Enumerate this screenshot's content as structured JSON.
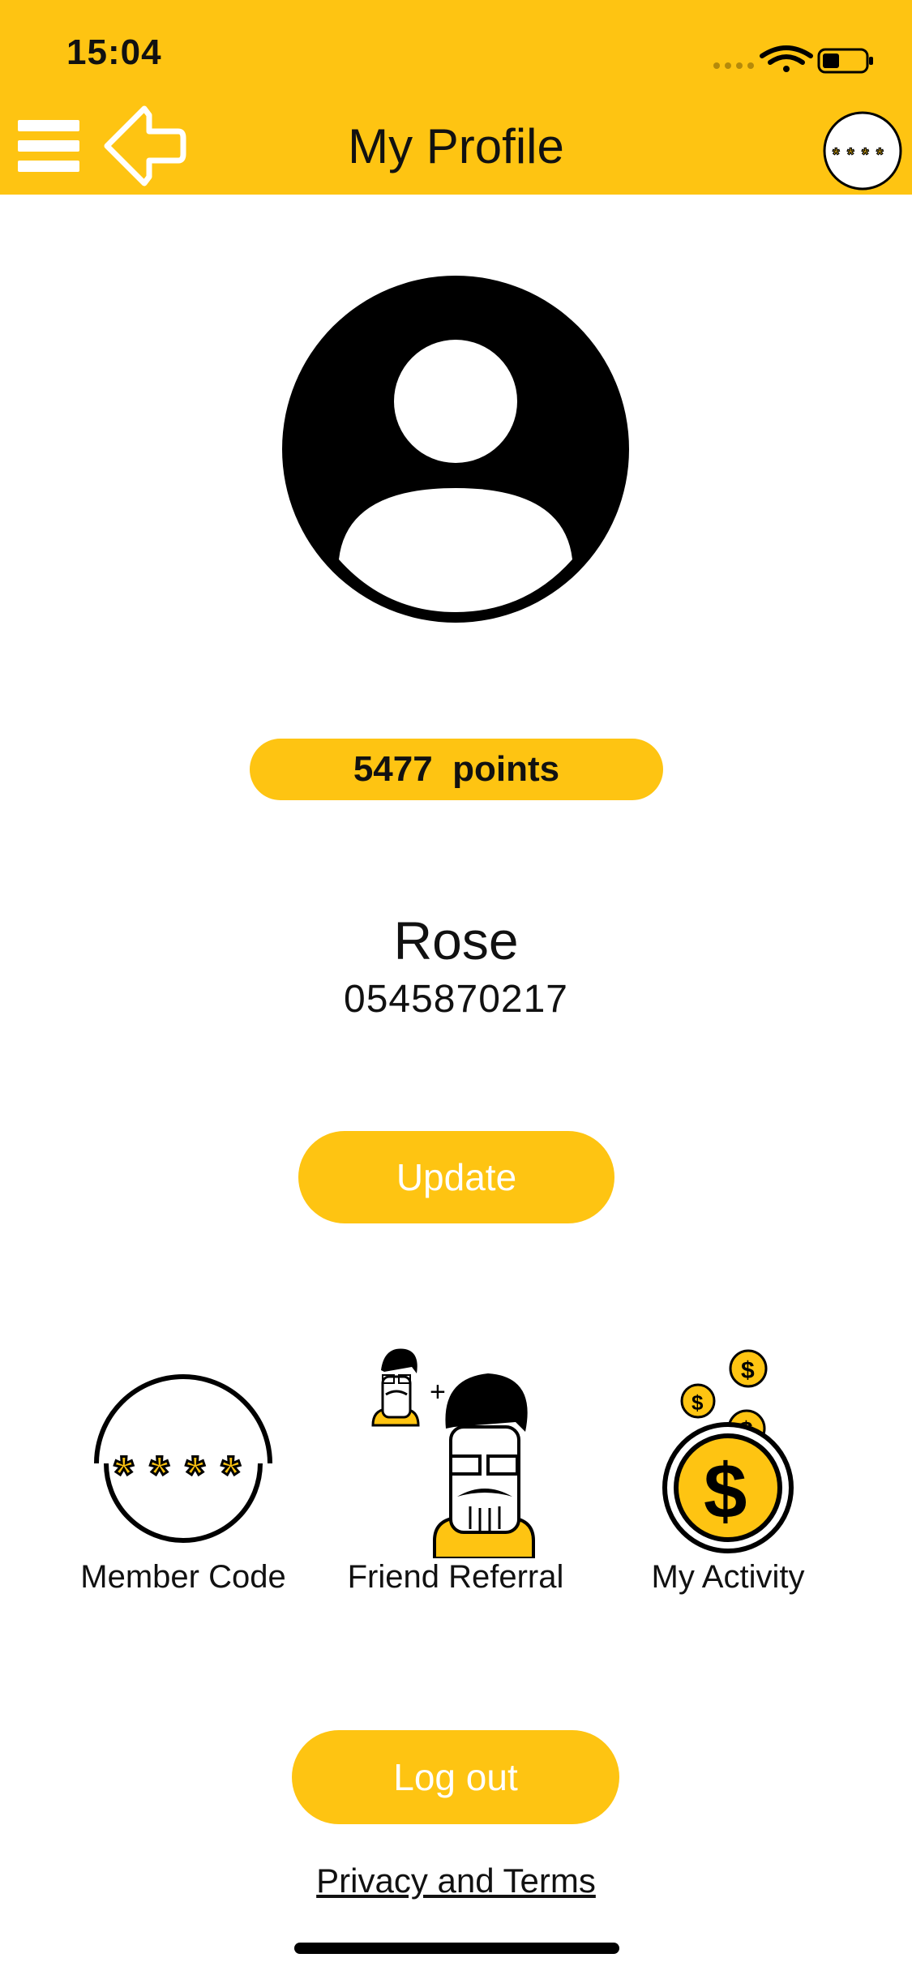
{
  "status_bar": {
    "time": "15:04"
  },
  "header": {
    "title": "My Profile"
  },
  "profile": {
    "points_value": "5477",
    "points_unit": "points",
    "name": "Rose",
    "phone": "0545870217",
    "update_label": "Update"
  },
  "tiles": [
    {
      "label": "Member Code",
      "icon": "member-code-icon"
    },
    {
      "label": "Friend Referral",
      "icon": "friend-referral-icon"
    },
    {
      "label": "My Activity",
      "icon": "coin-dollar-icon"
    }
  ],
  "footer": {
    "logout_label": "Log out",
    "privacy_label": "Privacy and Terms"
  },
  "colors": {
    "accent": "#FEC412",
    "text": "#111111",
    "background": "#FFFFFF"
  }
}
